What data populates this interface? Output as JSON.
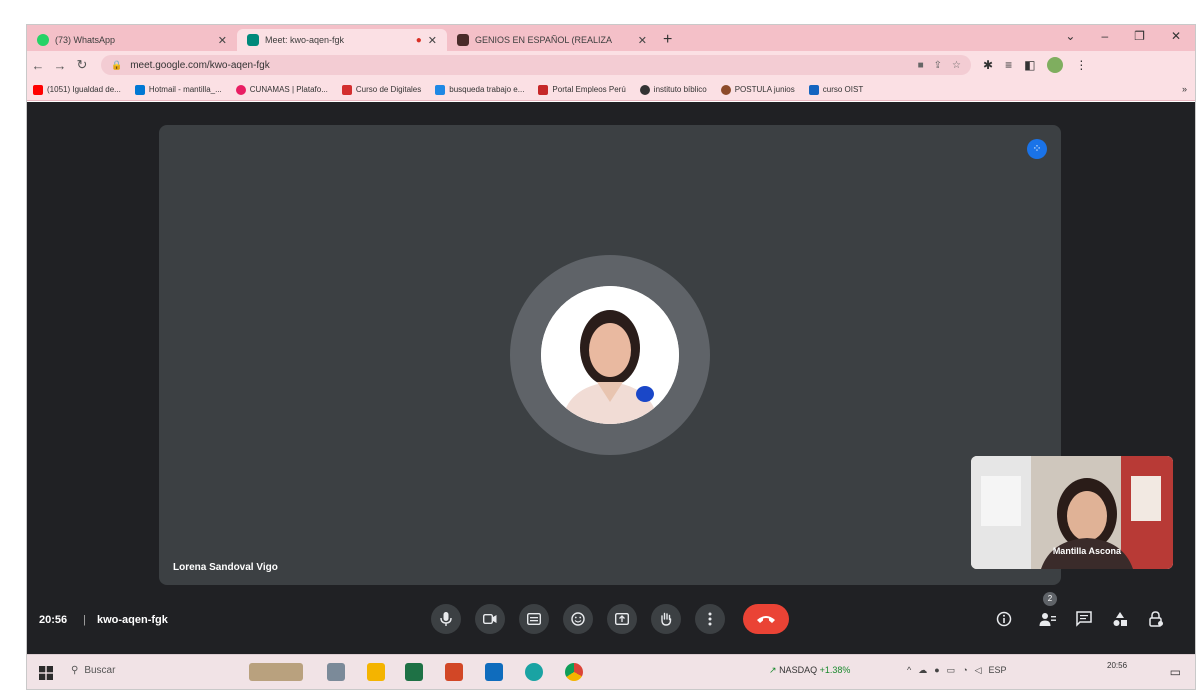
{
  "browser": {
    "tabs": [
      {
        "title": "(73) WhatsApp",
        "favicon_color": "#25d366"
      },
      {
        "title": "Meet: kwo-aqen-fgk",
        "favicon_color": "#00897b"
      },
      {
        "title": "GENIOS EN ESPAÑOL (REALIZA",
        "favicon_color": "#4a2c2a"
      }
    ],
    "new_tab_glyph": "+",
    "url": "meet.google.com/kwo-aqen-fgk",
    "bookmarks": [
      {
        "label": "(1051) Igualdad de...",
        "color": "#ff0000"
      },
      {
        "label": "Hotmail - mantilla_...",
        "color": "#0078d4"
      },
      {
        "label": "CUNAMAS | Platafo...",
        "color": "#e91e63"
      },
      {
        "label": "Curso de Digitales",
        "color": "#d32f2f"
      },
      {
        "label": "busqueda trabajo e...",
        "color": "#1e88e5"
      },
      {
        "label": "Portal Empleos Perú",
        "color": "#c62828"
      },
      {
        "label": "instituto bíblico",
        "color": "#333333"
      },
      {
        "label": "POSTULA junios",
        "color": "#8d4b2a"
      },
      {
        "label": "curso OIST",
        "color": "#1565c0"
      }
    ]
  },
  "meet": {
    "speaker_name": "Lorena Sandoval Vigo",
    "self_name": "Mantilla Ascona",
    "clock": "20:56",
    "separator": "|",
    "meeting_code": "kwo-aqen-fgk",
    "participants_badge": "2"
  },
  "taskbar": {
    "search_placeholder": "Buscar",
    "news_label": "NASDAQ",
    "news_change": "+1.38%",
    "tray_lang": "ESP",
    "time": "20:56"
  }
}
